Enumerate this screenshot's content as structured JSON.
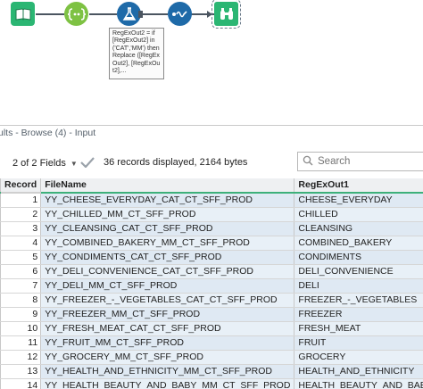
{
  "workflow": {
    "tools": [
      {
        "name": "input-tool",
        "icon": "book-icon",
        "color": "#2bb673"
      },
      {
        "name": "select-tool",
        "icon": "select-brackets-icon",
        "color": "#7ec243"
      },
      {
        "name": "formula-tool",
        "icon": "flask-icon",
        "color": "#1e6aa8"
      },
      {
        "name": "filter-tool",
        "icon": "dot-wave-icon",
        "color": "#1e6aa8"
      },
      {
        "name": "browse-tool",
        "icon": "binoculars-icon",
        "color": "#2bb673"
      }
    ],
    "annotation": "RegExOut2 = if [RegExOut2] in ('CAT','MM') then Replace ([RegExOut2], [RegExOut2],..."
  },
  "results": {
    "header_title": "ults - Browse (4) - Input",
    "fields_label": "2 of 2 Fields",
    "records_info": "36 records displayed, 2164 bytes",
    "search_placeholder": "Search",
    "columns": [
      "Record",
      "FileName",
      "RegExOut1"
    ],
    "rows": [
      {
        "record": "1",
        "filename": "YY_CHEESE_EVERYDAY_CAT_CT_SFF_PROD",
        "regex": "CHEESE_EVERYDAY"
      },
      {
        "record": "2",
        "filename": "YY_CHILLED_MM_CT_SFF_PROD",
        "regex": "CHILLED"
      },
      {
        "record": "3",
        "filename": "YY_CLEANSING_CAT_CT_SFF_PROD",
        "regex": "CLEANSING"
      },
      {
        "record": "4",
        "filename": "YY_COMBINED_BAKERY_MM_CT_SFF_PROD",
        "regex": "COMBINED_BAKERY"
      },
      {
        "record": "5",
        "filename": "YY_CONDIMENTS_CAT_CT_SFF_PROD",
        "regex": "CONDIMENTS"
      },
      {
        "record": "6",
        "filename": "YY_DELI_CONVENIENCE_CAT_CT_SFF_PROD",
        "regex": "DELI_CONVENIENCE"
      },
      {
        "record": "7",
        "filename": "YY_DELI_MM_CT_SFF_PROD",
        "regex": "DELI"
      },
      {
        "record": "8",
        "filename": "YY_FREEZER_-_VEGETABLES_CAT_CT_SFF_PROD",
        "regex": "FREEZER_-_VEGETABLES"
      },
      {
        "record": "9",
        "filename": "YY_FREEZER_MM_CT_SFF_PROD",
        "regex": "FREEZER"
      },
      {
        "record": "10",
        "filename": "YY_FRESH_MEAT_CAT_CT_SFF_PROD",
        "regex": "FRESH_MEAT"
      },
      {
        "record": "11",
        "filename": "YY_FRUIT_MM_CT_SFF_PROD",
        "regex": "FRUIT"
      },
      {
        "record": "12",
        "filename": "YY_GROCERY_MM_CT_SFF_PROD",
        "regex": "GROCERY"
      },
      {
        "record": "13",
        "filename": "YY_HEALTH_AND_ETHNICITY_MM_CT_SFF_PROD",
        "regex": "HEALTH_AND_ETHNICITY"
      },
      {
        "record": "14",
        "filename": "YY_HEALTH_BEAUTY_AND_BABY_MM_CT_SFF_PROD",
        "regex": "HEALTH_BEAUTY_AND_BABY"
      }
    ]
  }
}
